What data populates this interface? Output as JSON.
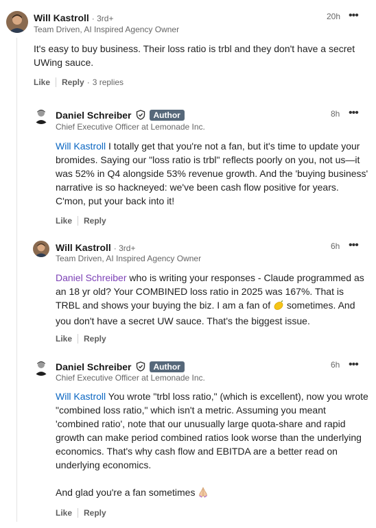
{
  "comments": [
    {
      "name": "Will Kastroll",
      "degree": "· 3rd+",
      "headline": "Team Driven, AI Inspired Agency Owner",
      "time": "20h",
      "text": "It's easy to buy business. Their loss ratio is trbl and they don't have a secret UWing sauce.",
      "like": "Like",
      "reply": "Reply",
      "replies": "3 replies"
    },
    {
      "name": "Daniel Schreiber",
      "badge": "Author",
      "headline": "Chief Executive Officer at Lemonade Inc.",
      "time": "8h",
      "mention": "Will Kastroll",
      "text": " I totally get that you're not a fan, but it's time to update your bromides. Saying our \"loss ratio is trbl\" reflects poorly on you, not us—it was 52% in Q4 alongside 53% revenue growth. And the 'buying business' narrative is so hackneyed: we've been cash flow positive for years. C'mon, put your back into it!",
      "like": "Like",
      "reply": "Reply"
    },
    {
      "name": "Will Kastroll",
      "degree": "· 3rd+",
      "headline": "Team Driven, AI Inspired Agency Owner",
      "time": "6h",
      "mention": "Daniel Schreiber",
      "text": " who is writing your responses - Claude programmed as an 18 yr old? Your COMBINED loss ratio in 2025 was 167%. That is TRBL and shows your buying the biz. I am a fan of ",
      "text_after": " sometimes. And you don't have a secret UW sauce. That's the biggest issue.",
      "like": "Like",
      "reply": "Reply"
    },
    {
      "name": "Daniel Schreiber",
      "badge": "Author",
      "headline": "Chief Executive Officer at Lemonade Inc.",
      "time": "6h",
      "mention": "Will Kastroll",
      "text": " You wrote \"trbl loss ratio,\" (which is excellent), now you wrote \"combined loss ratio,\" which isn't a metric. Assuming you meant 'combined ratio', note that our unusually large quota-share and rapid growth can make period combined ratios look worse than the underlying economics. That's why cash flow and EBITDA are a better read on underlying economics.",
      "text2": "And glad you're a fan sometimes ",
      "like": "Like",
      "reply": "Reply"
    }
  ],
  "icons": {
    "more": "more-horizontal-icon",
    "verified": "verified-shield-icon",
    "lemon": "lemon-emoji",
    "pray": "folded-hands-emoji"
  },
  "colors": {
    "mention_blue": "#0a66c2",
    "mention_purple": "#7b3fb5",
    "author_badge": "#56687a"
  }
}
